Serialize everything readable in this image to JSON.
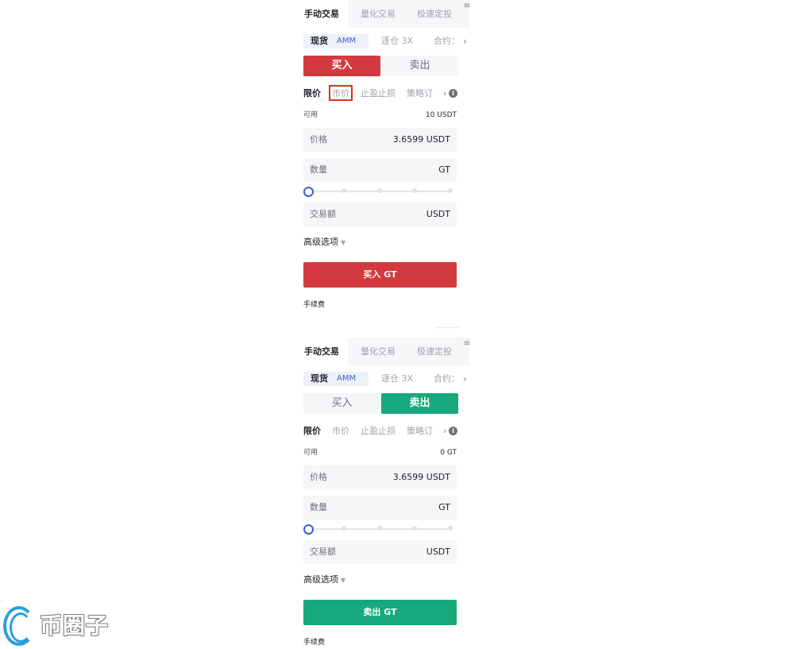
{
  "tabs": {
    "manual": "手动交易",
    "quant": "量化交易",
    "auto_invest": "极速定投"
  },
  "market": {
    "spot": "现货",
    "amm": "AMM",
    "margin": "逐仓 3X",
    "contract": "合约："
  },
  "order_types": {
    "limit": "限价",
    "market": "市价",
    "tp_sl": "止盈止损",
    "strategy": "策略订"
  },
  "side": {
    "buy": "买入",
    "sell": "卖出"
  },
  "fields": {
    "available_label": "可用",
    "price_label": "价格",
    "quantity_label": "数量",
    "total_label": "交易额"
  },
  "advanced_label": "高级选项",
  "fee_label": "手续费",
  "buy_panel": {
    "available": "10 USDT",
    "price": "3.6599 USDT",
    "quantity_unit": "GT",
    "total_unit": "USDT",
    "submit": "买入 GT",
    "slider_percent": 0
  },
  "sell_panel": {
    "available": "0 GT",
    "price": "3.6599 USDT",
    "quantity_unit": "GT",
    "total_unit": "USDT",
    "submit": "卖出 GT",
    "slider_percent": 0
  },
  "watermark": "币圈子",
  "colors": {
    "buy": "#d33a3f",
    "sell": "#17a97b",
    "accent": "#3b5fd1",
    "highlight_box": "#d9331b"
  },
  "icons": {
    "menu": "menu-icon",
    "info": "info-icon",
    "chevron": "chevron-right-icon",
    "caret": "caret-down-icon"
  }
}
